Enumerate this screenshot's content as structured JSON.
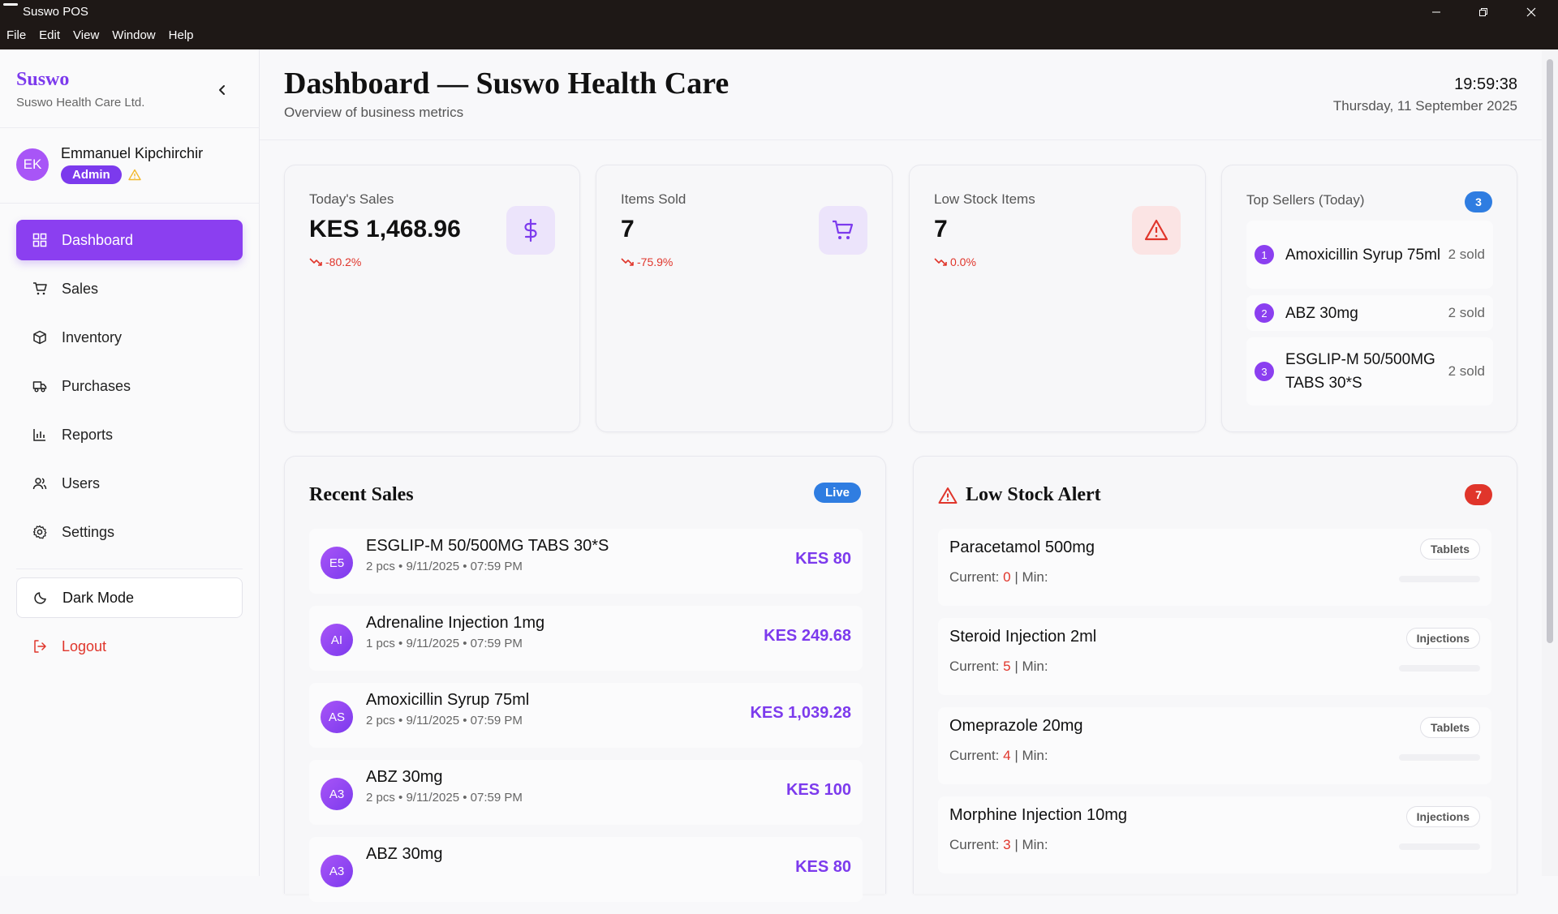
{
  "window": {
    "title": "Suswo POS",
    "menu": [
      "File",
      "Edit",
      "View",
      "Window",
      "Help"
    ]
  },
  "sidebar": {
    "brand": "Suswo",
    "company": "Suswo Health Care Ltd.",
    "user": {
      "initials": "EK",
      "name": "Emmanuel Kipchirchir",
      "role": "Admin"
    },
    "nav": [
      {
        "label": "Dashboard",
        "icon": "dashboard-icon",
        "active": true
      },
      {
        "label": "Sales",
        "icon": "cart-icon"
      },
      {
        "label": "Inventory",
        "icon": "box-icon"
      },
      {
        "label": "Purchases",
        "icon": "truck-icon"
      },
      {
        "label": "Reports",
        "icon": "bar-chart-icon"
      },
      {
        "label": "Users",
        "icon": "users-icon"
      },
      {
        "label": "Settings",
        "icon": "gear-icon"
      }
    ],
    "dark_mode": "Dark Mode",
    "logout": "Logout"
  },
  "header": {
    "title": "Dashboard — Suswo Health Care",
    "subtitle": "Overview of business metrics",
    "time": "19:59:38",
    "date": "Thursday, 11 September 2025"
  },
  "stats": [
    {
      "label": "Today's Sales",
      "value": "KES 1,468.96",
      "change": "-80.2%",
      "icon": "dollar-icon",
      "icon_color": "#7c3aed"
    },
    {
      "label": "Items Sold",
      "value": "7",
      "change": "-75.9%",
      "icon": "cart-icon",
      "icon_color": "#7c3aed"
    },
    {
      "label": "Low Stock Items",
      "value": "7",
      "change": "0.0%",
      "icon": "warning-icon",
      "icon_color": "#e0352b"
    }
  ],
  "top_sellers": {
    "title": "Top Sellers (Today)",
    "count": "3",
    "items": [
      {
        "rank": "1",
        "name": "Amoxicillin Syrup 75ml",
        "sold": "2 sold"
      },
      {
        "rank": "2",
        "name": "ABZ 30mg",
        "sold": "2 sold"
      },
      {
        "rank": "3",
        "name": "ESGLIP-M 50/500MG TABS 30*S",
        "sold": "2 sold"
      }
    ]
  },
  "recent_sales": {
    "title": "Recent Sales",
    "badge": "Live",
    "items": [
      {
        "initials": "E5",
        "name": "ESGLIP-M 50/500MG TABS 30*S",
        "meta": "2 pcs • 9/11/2025 • 07:59 PM",
        "amount": "KES 80"
      },
      {
        "initials": "AI",
        "name": "Adrenaline Injection 1mg",
        "meta": "1 pcs • 9/11/2025 • 07:59 PM",
        "amount": "KES 249.68"
      },
      {
        "initials": "AS",
        "name": "Amoxicillin Syrup 75ml",
        "meta": "2 pcs • 9/11/2025 • 07:59 PM",
        "amount": "KES 1,039.28"
      },
      {
        "initials": "A3",
        "name": "ABZ 30mg",
        "meta": "2 pcs • 9/11/2025 • 07:59 PM",
        "amount": "KES 100"
      },
      {
        "initials": "A3",
        "name": "ABZ 30mg",
        "meta": "",
        "amount": "KES 80"
      }
    ]
  },
  "low_stock": {
    "title": "Low Stock Alert",
    "count": "7",
    "current_label": "Current:",
    "min_label": "| Min:",
    "items": [
      {
        "name": "Paracetamol 500mg",
        "current": "0",
        "category": "Tablets"
      },
      {
        "name": "Steroid Injection 2ml",
        "current": "5",
        "category": "Injections"
      },
      {
        "name": "Omeprazole 20mg",
        "current": "4",
        "category": "Tablets"
      },
      {
        "name": "Morphine Injection 10mg",
        "current": "3",
        "category": "Injections"
      }
    ]
  }
}
